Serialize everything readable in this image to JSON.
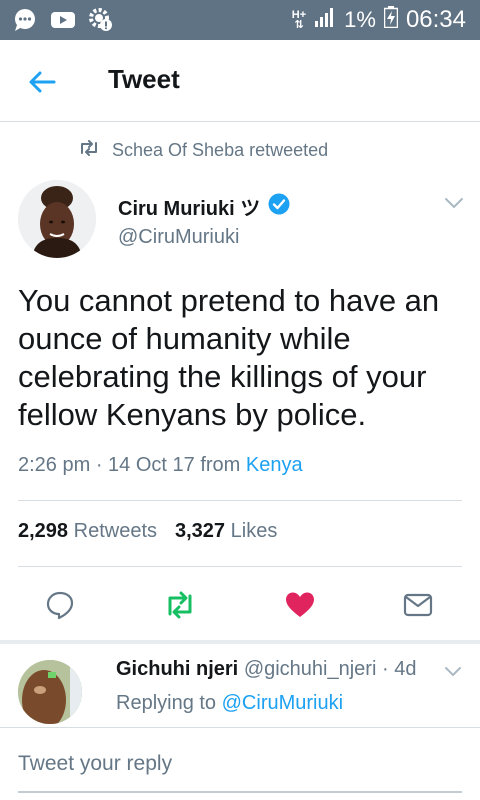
{
  "status_bar": {
    "network": "H+",
    "battery": "1%",
    "time": "06:34",
    "icons": [
      "chat-bubble-icon",
      "video-icon",
      "settings-notification-icon",
      "signal-icon",
      "battery-charging-icon"
    ]
  },
  "header": {
    "title": "Tweet"
  },
  "retweet_context": "Schea Of Sheba retweeted",
  "tweet": {
    "name": "Ciru Muriuki ツ",
    "handle": "@CiruMuriuki",
    "text": "You cannot pretend to have an ounce of humanity while celebrating the killings of your fellow Kenyans by police.",
    "time": "2:26 pm · 14 Oct 17",
    "from_label": "from",
    "location": "Kenya",
    "retweets_count": "2,298",
    "retweets_label": "Retweets",
    "likes_count": "3,327",
    "likes_label": "Likes"
  },
  "colors": {
    "accent": "#1da1f2",
    "retweet": "#17bf63",
    "like": "#e0245e",
    "status_bar": "#607384",
    "secondary": "#657786"
  },
  "reply": {
    "name": "Gichuhi njeri",
    "handle": "@gichuhi_njeri",
    "age": "· 4d",
    "replying_label": "Replying to",
    "replying_to": "@CiruMuriuki"
  },
  "compose": {
    "placeholder": "Tweet your reply"
  }
}
